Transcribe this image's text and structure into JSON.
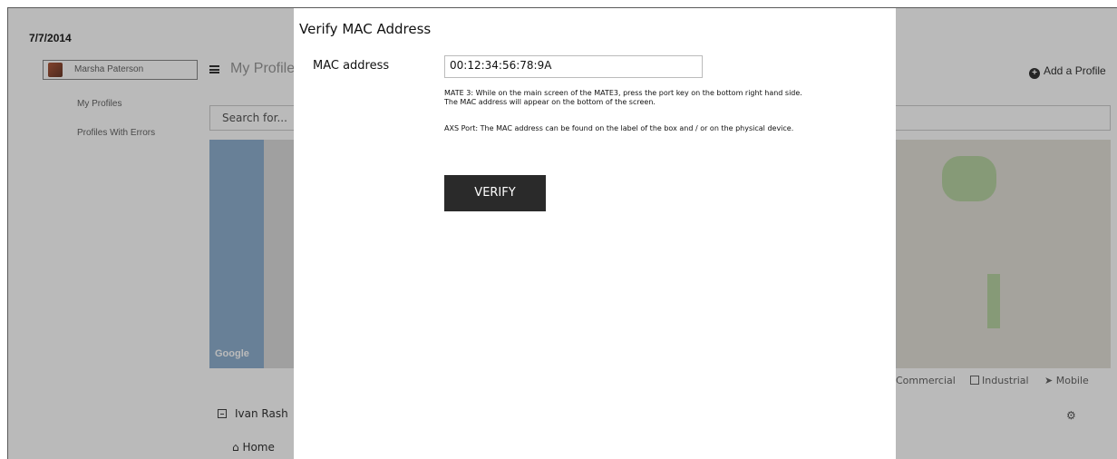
{
  "date": "7/7/2014",
  "sidebar": {
    "user_name": "Marsha Paterson",
    "items": [
      {
        "label": "My Profiles"
      },
      {
        "label": "Profiles With Errors"
      }
    ]
  },
  "header": {
    "title": "My Profiles",
    "add_profile": "Add a Profile"
  },
  "search": {
    "placeholder": "Search for..."
  },
  "map": {
    "logo": "Google"
  },
  "legend": {
    "commercial": "Commercial",
    "industrial": "Industrial",
    "mobile": "Mobile"
  },
  "owner": {
    "name": "Ivan Rash"
  },
  "nav": {
    "home": "Home"
  },
  "modal": {
    "title": "Verify MAC Address",
    "mac_label": "MAC address",
    "mac_value": "00:12:34:56:78:9A",
    "help_mate3_line1": "MATE 3:  While on the main screen of the MATE3, press the port key on the bottom right hand side.",
    "help_mate3_line2": "The MAC address will appear on the bottom of the screen.",
    "help_axs": "AXS Port:  The MAC address can be found on the label of the box and / or on the physical device.",
    "verify_label": "VERIFY"
  },
  "colors": {
    "overlay": "#000000",
    "button_bg": "#2a2a2a",
    "water": "#8fb0d0",
    "park": "#b8d4a4"
  }
}
